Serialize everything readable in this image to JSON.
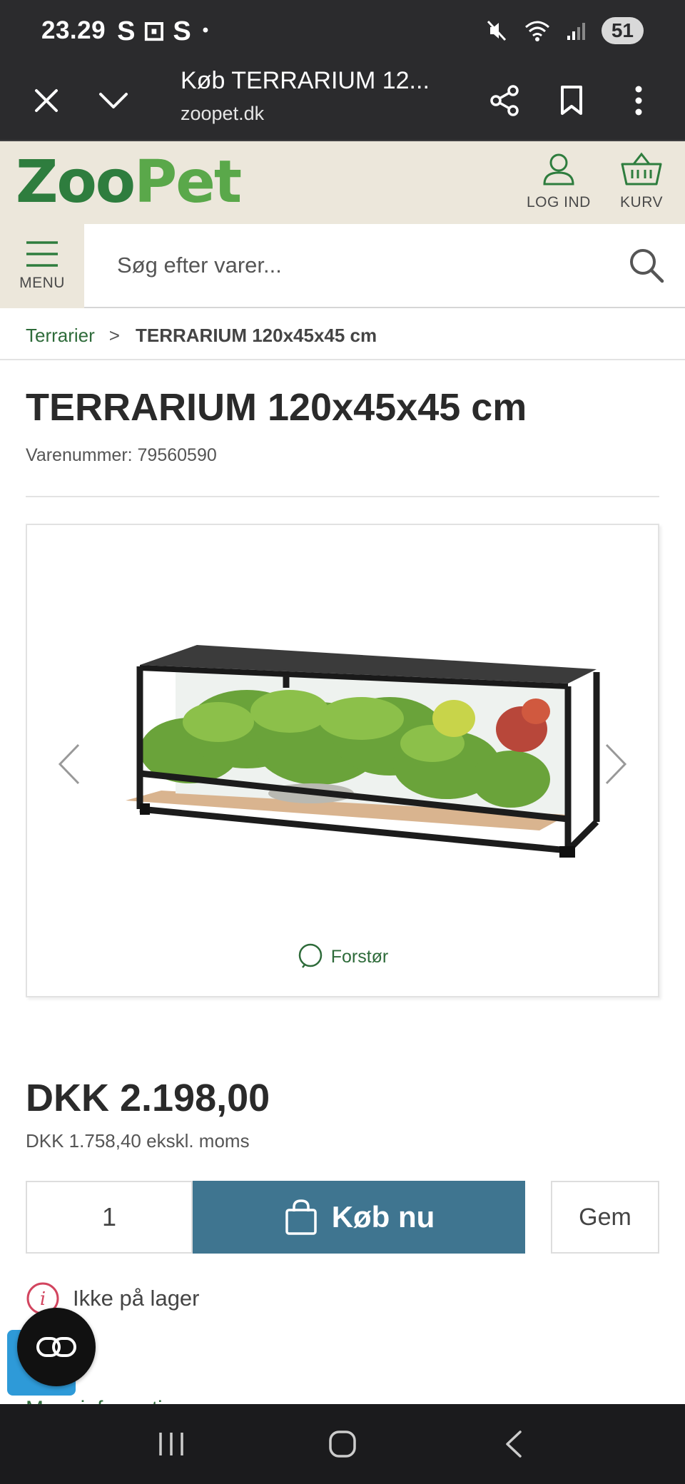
{
  "status_bar": {
    "time": "23.29",
    "left_glyphs": "S ⊡ S",
    "dot": "•",
    "battery": "51"
  },
  "browser": {
    "title": "Køb TERRARIUM 12...",
    "url": "zoopet.dk"
  },
  "header": {
    "logo_zoo": "Zoo",
    "logo_pet": "Pet",
    "login_label": "LOG IND",
    "cart_label": "KURV"
  },
  "search": {
    "menu_label": "MENU",
    "placeholder": "Søg efter varer..."
  },
  "breadcrumb": {
    "parent": "Terrarier",
    "separator": ">",
    "current": "TERRARIUM 120x45x45 cm"
  },
  "product": {
    "title": "TERRARIUM 120x45x45 cm",
    "sku": "Varenummer: 79560590",
    "zoom_label": "Forstør",
    "price": "DKK 2.198,00",
    "price_ex_vat": "DKK 1.758,40 ekskl. moms",
    "quantity": "1",
    "buy_label": "Køb nu",
    "save_label": "Gem",
    "stock_status": "Ikke på lager",
    "more_info": "Mere information"
  },
  "colors": {
    "brand_green": "#2e7d3e",
    "buy_button": "#3f7590",
    "header_bg": "#ece7db",
    "stock_icon": "#d2455f"
  }
}
